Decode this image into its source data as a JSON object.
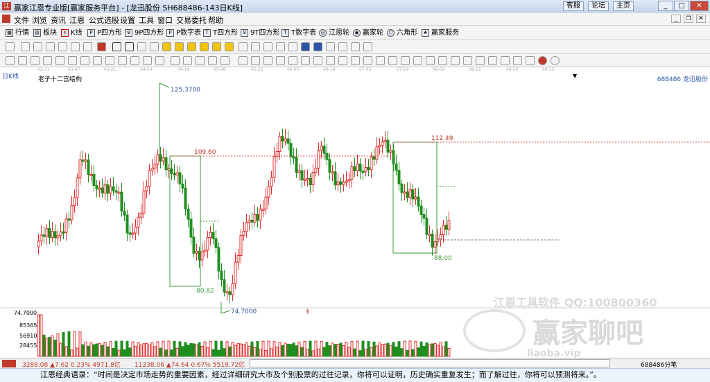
{
  "window": {
    "title": "赢家江恩专业版[赢家服务平台] - [龙迅股份  SH688486-143日K线]",
    "buttons": [
      "客服",
      "论坛",
      "主页"
    ],
    "logo_text": "江"
  },
  "menu": [
    "文件",
    "浏览",
    "资讯",
    "江恩",
    "公式选股",
    "设置",
    "工具",
    "窗口",
    "交易委托",
    "帮助"
  ],
  "toolbar": [
    {
      "label": "行情",
      "icon": "grid-icon"
    },
    {
      "label": "板块",
      "icon": "blocks-icon"
    },
    {
      "label": "K线",
      "icon": "kline-icon"
    },
    {
      "label": "P四方形",
      "icon": "p-square-icon"
    },
    {
      "label": "9P四方形",
      "icon": "9p-square-icon"
    },
    {
      "label": "P数字表",
      "icon": "p-table-icon"
    },
    {
      "label": "T四方形",
      "icon": "t-square-icon"
    },
    {
      "label": "9T四方形",
      "icon": "9t-square-icon"
    },
    {
      "label": "T数字表",
      "icon": "t-table-icon"
    },
    {
      "label": "江恩轮",
      "icon": "gann-wheel-icon"
    },
    {
      "label": "赢家轮",
      "icon": "winner-wheel-icon"
    },
    {
      "label": "六角形",
      "icon": "hexagon-icon"
    },
    {
      "label": "赢家服务",
      "icon": "service-icon"
    }
  ],
  "date_axis": [
    "02-21",
    "03-07",
    "03-21",
    "04-04",
    "04-19",
    "05-08",
    "05-22",
    "06-05",
    "06-19",
    "07-05",
    "07-19",
    "08-02",
    "08-16",
    "08-30",
    "09-13"
  ],
  "chart_header": {
    "period": "日K线",
    "indicator": "老子十二宫结构",
    "code": "688486  龙迅股份"
  },
  "chart_data": {
    "type": "candlestick",
    "annotations": {
      "high": "125.3700",
      "low": "74.7000",
      "box1_top": "109.60",
      "box1_bottom": "80.82",
      "box2_top": "112.49",
      "box2_bottom": "88.00",
      "marker": "$"
    },
    "volume_axis": [
      "74.7000",
      "85365",
      "56910",
      "28455"
    ],
    "ylim": [
      70,
      130
    ]
  },
  "status": {
    "sh_index": "3288.08 ▲7.62 0.23% 4971.8亿",
    "sz_index": "11238.06 ▲74.64 0.67% 5519.72亿",
    "right": "688486分笔"
  },
  "watermark": {
    "line1": "江恩工具软件  QQ:100800360",
    "line2": "赢家聊吧",
    "line3": "liaoba.vip"
  },
  "quote": "江恩经典语录：“时间是决定市场走势的重要因素，经过详细研究大市及个别股票的过往记录，你将可以证明，历史确实重复发生；而了解过往，你将可以预测将来。”。"
}
